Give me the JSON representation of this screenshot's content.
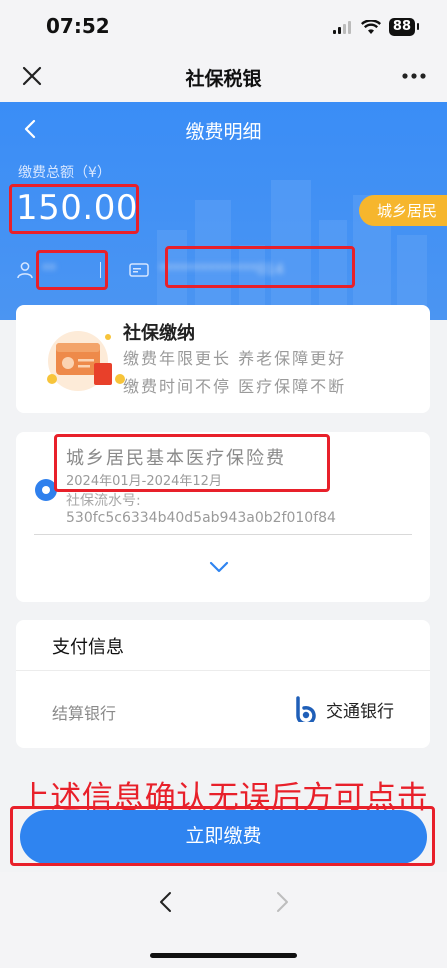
{
  "status_bar": {
    "time": "07:52",
    "battery": "88"
  },
  "app": {
    "title": "社保税银"
  },
  "page": {
    "title": "缴费明细",
    "amount_label": "缴费总额（¥）",
    "amount": "150.00",
    "category_tag": "城乡居民",
    "name_masked": "**",
    "card_masked": "**************014"
  },
  "shebao_card": {
    "title": "社保缴纳",
    "line1": "缴费年限更长 养老保障更好",
    "line2": "缴费时间不停 医疗保障不断",
    "illustration_badge": "社保"
  },
  "insurance": {
    "name": "城乡居民基本医疗保险费",
    "period": "2024年01月-2024年12月",
    "flow_label": "社保流水号:",
    "flow_id": "530fc5c6334b40d5ab943a0b2f010f84"
  },
  "payment_info": {
    "title": "支付信息",
    "bank_label": "结算银行",
    "bank_name": "交通银行"
  },
  "notice": "上述信息确认无误后方可点击",
  "pay_button": "立即缴费",
  "colors": {
    "primary": "#2f84f0",
    "tag": "#f6b62d",
    "annotation": "#e8202a"
  }
}
